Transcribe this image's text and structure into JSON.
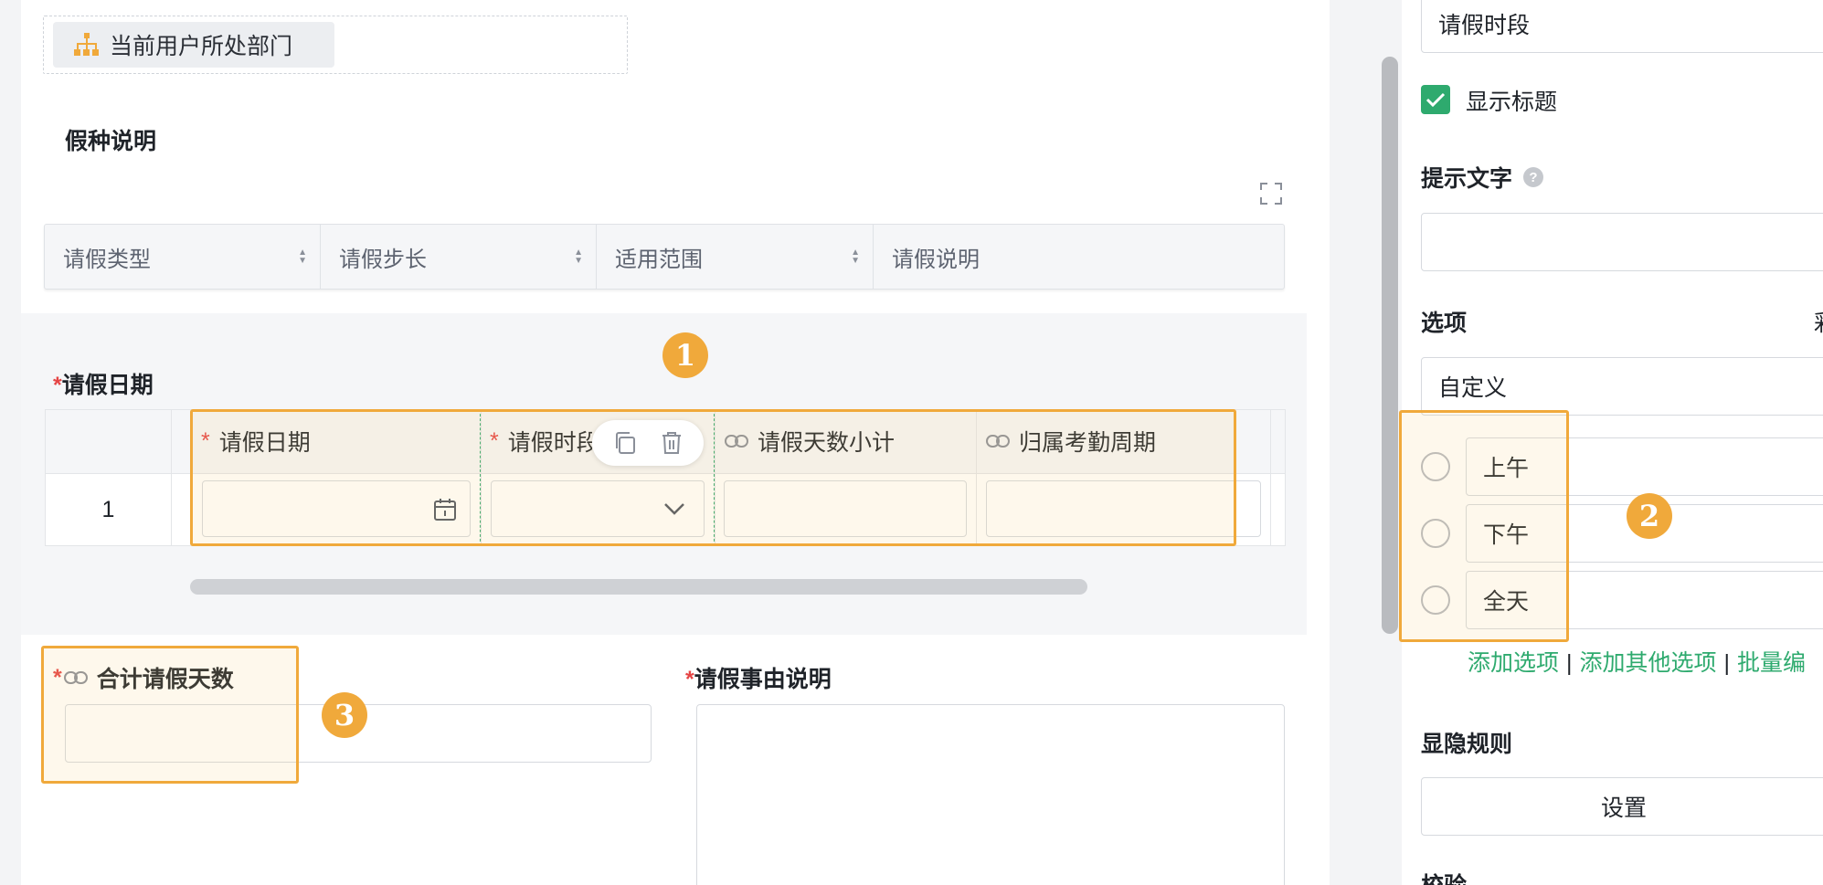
{
  "canvas": {
    "department_chip": "当前用户所处部门",
    "leave_type_section": {
      "title": "假种说明",
      "columns": [
        "请假类型",
        "请假步长",
        "适用范围",
        "请假说明"
      ]
    },
    "leave_date_subform": {
      "title": "请假日期",
      "required_mark": "*",
      "columns": [
        {
          "label": "请假日期",
          "required": "*"
        },
        {
          "label": "请假时段",
          "required": "*"
        },
        {
          "label": "请假天数小计"
        },
        {
          "label": "归属考勤周期"
        }
      ],
      "row_number": "1"
    },
    "total_days": {
      "label": "合计请假天数",
      "required_mark": "*"
    },
    "reason": {
      "label": "请假事由说明",
      "required_mark": "*"
    }
  },
  "annotations": {
    "badge1": "1",
    "badge2": "2",
    "badge3": "3"
  },
  "panel": {
    "title_value": "请假时段",
    "show_title_label": "显示标题",
    "hint_label": "提示文字",
    "hint_help": "?",
    "options_label": "选项",
    "options_label_right": "彩",
    "options_source": "自定义",
    "options": [
      "上午",
      "下午",
      "全天"
    ],
    "links": {
      "add_option": "添加选项",
      "add_other": "添加其他选项",
      "batch": "批量编"
    },
    "separator": "|",
    "visibility_label": "显隐规则",
    "settings_button": "设置",
    "validation_label": "校验"
  },
  "colors": {
    "accent_green": "#2eaa6e",
    "highlight_orange": "#f0a93b",
    "required_red": "#e54545"
  }
}
